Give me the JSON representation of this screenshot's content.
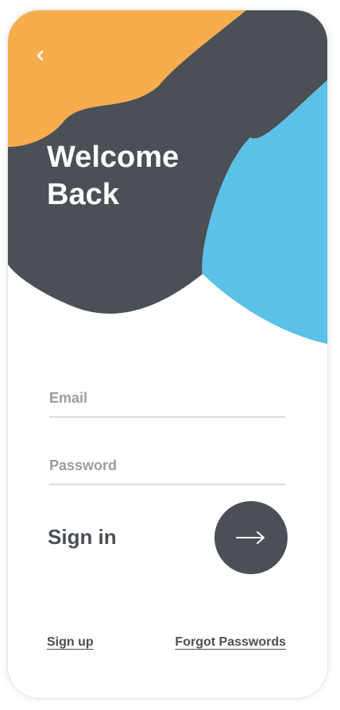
{
  "colors": {
    "orange": "#f7ad4c",
    "dark": "#4b4f56",
    "blue": "#5bc1e6",
    "white": "#ffffff",
    "divider": "#dcdcdc",
    "placeholder": "#9d9b9d"
  },
  "header": {
    "back_icon": "chevron-left-icon",
    "title_line1": "Welcome",
    "title_line2": "Back"
  },
  "form": {
    "email": {
      "placeholder": "Email",
      "value": ""
    },
    "password": {
      "placeholder": "Password",
      "value": ""
    },
    "signin_label": "Sign in",
    "submit_icon": "arrow-right-icon"
  },
  "links": {
    "sign_up": "Sign up",
    "forgot": "Forgot Passwords"
  }
}
